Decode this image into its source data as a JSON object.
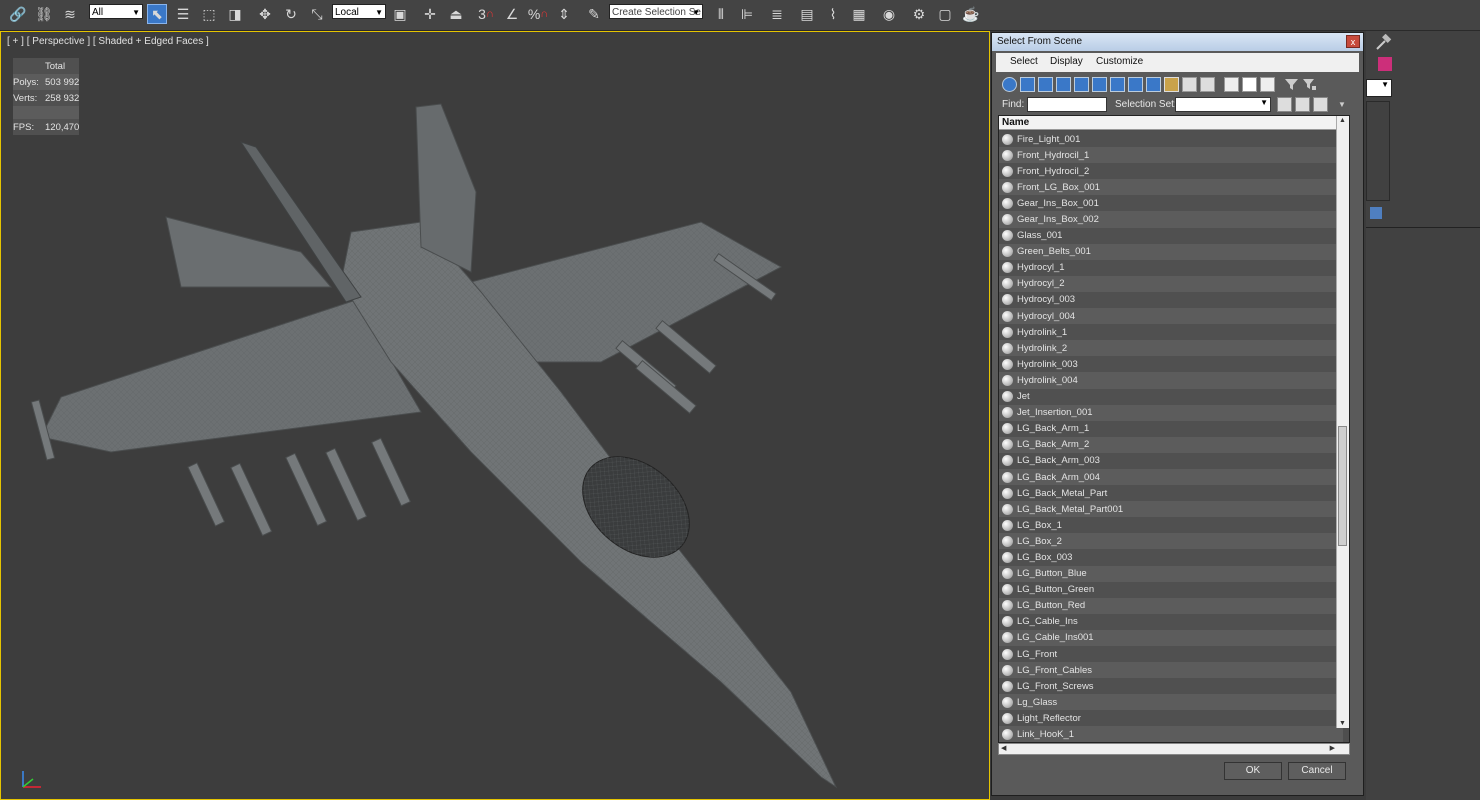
{
  "toolbar": {
    "selection_filter": "All",
    "reference_coord": "Local",
    "selection_set_placeholder": "Create Selection Se",
    "snap_label": "3",
    "percent_snap_label": "%"
  },
  "viewport": {
    "label": "[ + ] [ Perspective ] [ Shaded + Edged Faces ]",
    "stats": {
      "total_label": "Total",
      "polys_label": "Polys:",
      "polys_value": "503 992",
      "verts_label": "Verts:",
      "verts_value": "258 932",
      "fps_label": "FPS:",
      "fps_value": "120,470"
    }
  },
  "dialog": {
    "title": "Select From Scene",
    "close_label": "x",
    "menu": [
      "Select",
      "Display",
      "Customize"
    ],
    "find_label": "Find:",
    "selection_set_label": "Selection Set:",
    "column_name": "Name",
    "items": [
      "Fire_Light_001",
      "Front_Hydrocil_1",
      "Front_Hydrocil_2",
      "Front_LG_Box_001",
      "Gear_Ins_Box_001",
      "Gear_Ins_Box_002",
      "Glass_001",
      "Green_Belts_001",
      "Hydrocyl_1",
      "Hydrocyl_2",
      "Hydrocyl_003",
      "Hydrocyl_004",
      "Hydrolink_1",
      "Hydrolink_2",
      "Hydrolink_003",
      "Hydrolink_004",
      "Jet",
      "Jet_Insertion_001",
      "LG_Back_Arm_1",
      "LG_Back_Arm_2",
      "LG_Back_Arm_003",
      "LG_Back_Arm_004",
      "LG_Back_Metal_Part",
      "LG_Back_Metal_Part001",
      "LG_Box_1",
      "LG_Box_2",
      "LG_Box_003",
      "LG_Button_Blue",
      "LG_Button_Green",
      "LG_Button_Red",
      "LG_Cable_Ins",
      "LG_Cable_Ins001",
      "LG_Front",
      "LG_Front_Cables",
      "LG_Front_Screws",
      "Lg_Glass",
      "Light_Reflector",
      "Link_HooK_1"
    ],
    "ok_label": "OK",
    "cancel_label": "Cancel"
  },
  "colors": {
    "accent_blue": "#3a78c8",
    "viewport_border": "#e5c400",
    "stats_text": "#f0e000",
    "panel_magenta": "#cc2f7a"
  }
}
